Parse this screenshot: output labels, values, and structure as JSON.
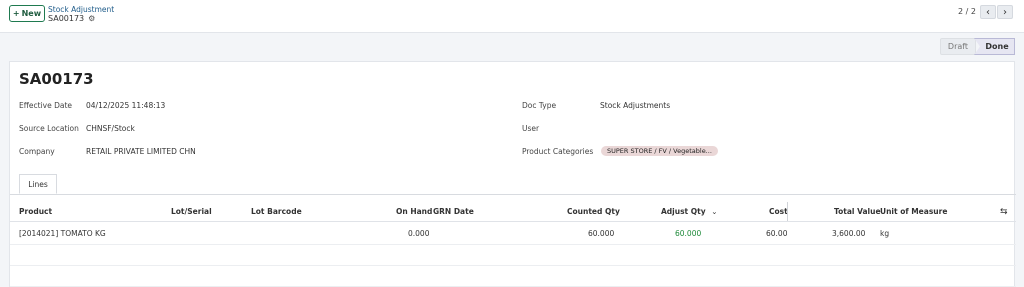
{
  "control_panel": {
    "new_label": "New",
    "breadcrumb_parent": "Stock Adjustment",
    "breadcrumb_current": "SA00173",
    "pager_value": "2 / 2"
  },
  "status": {
    "draft": "Draft",
    "done": "Done",
    "active": "Done"
  },
  "record": {
    "title": "SA00173",
    "fields": {
      "effective_date": {
        "label": "Effective Date",
        "value": "04/12/2025 11:48:13"
      },
      "source_location": {
        "label": "Source Location",
        "value": "CHNSF/Stock"
      },
      "company": {
        "label": "Company",
        "value": "RETAIL PRIVATE LIMITED CHN"
      },
      "doc_type": {
        "label": "Doc Type",
        "value": "Stock Adjustments"
      },
      "user": {
        "label": "User",
        "value": ""
      },
      "product_categories": {
        "label": "Product Categories",
        "tag": "SUPER STORE / FV / Vegetable..."
      }
    }
  },
  "tabs": [
    {
      "label": "Lines"
    }
  ],
  "lines_table": {
    "columns": {
      "product": "Product",
      "lot_serial": "Lot/Serial",
      "lot_barcode": "Lot Barcode",
      "on_hand": "On Hand",
      "grn_date": "GRN Date",
      "counted_qty": "Counted Qty",
      "adjust_qty": "Adjust Qty",
      "cost": "Cost",
      "total_value": "Total Value",
      "uom": "Unit of Measure"
    },
    "rows": [
      {
        "product": "[2014021] TOMATO KG",
        "lot_serial": "",
        "lot_barcode": "",
        "on_hand": "0.000",
        "grn_date": "",
        "counted_qty": "60.000",
        "adjust_qty": "60.000",
        "cost": "60.00",
        "total_value": "3,600.00",
        "uom": "kg"
      }
    ]
  },
  "icons": {
    "plus": "plus-icon",
    "gear": "gear-icon",
    "prev": "chevron-left-icon",
    "next": "chevron-right-icon",
    "sort": "chevron-down-icon",
    "optional_columns": "column-toggle-icon"
  },
  "colors": {
    "accent": "#1f7a50",
    "positive": "#1f8a3a",
    "tag_bg": "#ead7d7"
  }
}
